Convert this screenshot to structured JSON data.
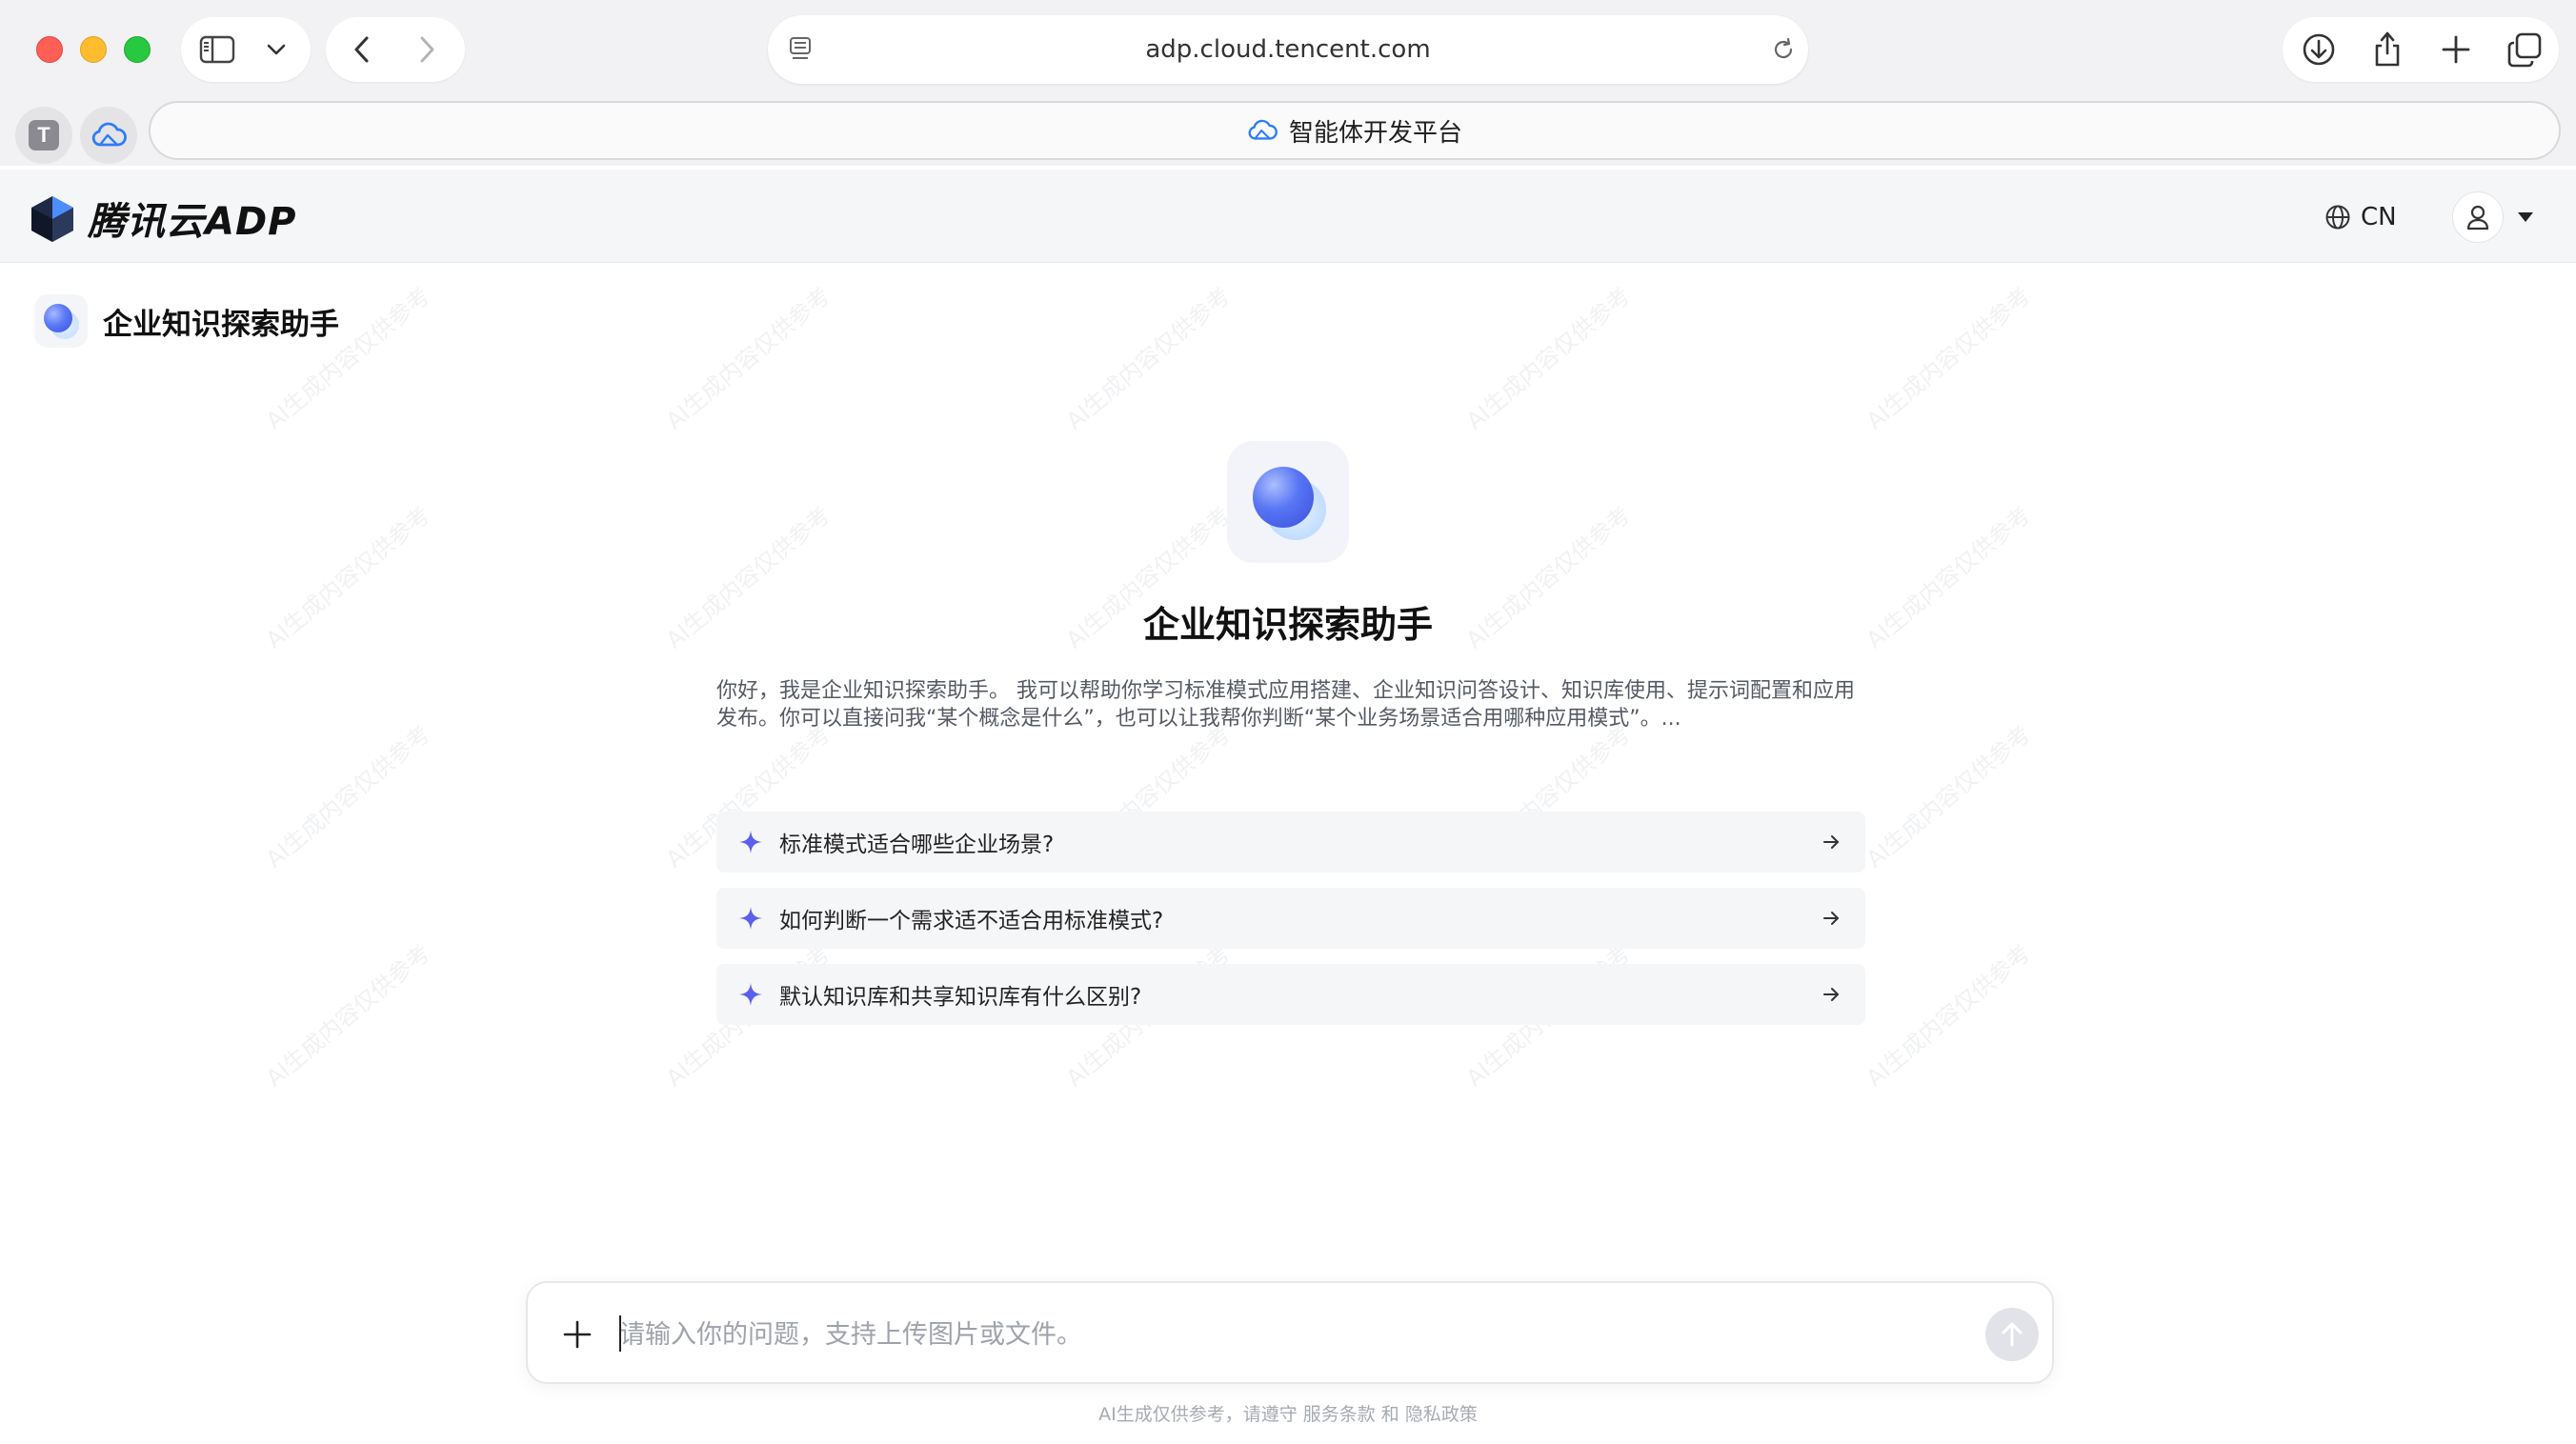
{
  "browser": {
    "url": "adp.cloud.tencent.com",
    "pinned_tab_letter": "T",
    "active_tab_title": "智能体开发平台"
  },
  "header": {
    "logo_text": "腾讯云ADP",
    "language": "CN"
  },
  "agent": {
    "name": "企业知识探索助手"
  },
  "hero": {
    "title": "企业知识探索助手",
    "description": "你好，我是企业知识探索助手。 我可以帮助你学习标准模式应用搭建、企业知识问答设计、知识库使用、提示词配置和应用发布。你可以直接问我“某个概念是什么”，也可以让我帮你判断“某个业务场景适合用哪种应用模式”。..."
  },
  "suggestions": [
    {
      "label": "标准模式适合哪些企业场景?"
    },
    {
      "label": "如何判断一个需求适不适合用标准模式?"
    },
    {
      "label": "默认知识库和共享知识库有什么区别?"
    }
  ],
  "composer": {
    "placeholder": "请输入你的问题，支持上传图片或文件。"
  },
  "footer": {
    "note": "AI生成仅供参考，请遵守 服务条款 和 隐私政策"
  },
  "watermark_text": "AI生成内容仅供参考",
  "colors": {
    "accent": "#5b6cf0",
    "spark": "#5b5ff0",
    "window_red": "#ff5f57",
    "window_yellow": "#febc2e",
    "window_green": "#28c840"
  }
}
